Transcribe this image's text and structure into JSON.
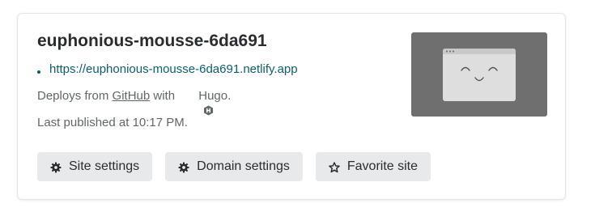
{
  "site": {
    "name": "euphonious-mousse-6da691",
    "url": "https://euphonious-mousse-6da691.netlify.app",
    "deploy_prefix": "Deploys from ",
    "deploy_provider": "GitHub",
    "deploy_with": " with ",
    "deploy_framework": "Hugo",
    "deploy_suffix": ".",
    "last_published": "Last published at 10:17 PM."
  },
  "buttons": {
    "site_settings": "Site settings",
    "domain_settings": "Domain settings",
    "favorite_site": "Favorite site"
  },
  "icons": {
    "status_dot": "status-dot",
    "framework": "hugo-icon",
    "site_settings": "gear-icon",
    "domain_settings": "gear-icon",
    "favorite": "star-outline-icon",
    "preview": "browser-smiley-placeholder"
  },
  "colors": {
    "link": "#0b5f6f",
    "muted_text": "#616668",
    "heading": "#2a2d30",
    "button_bg": "#e7e9eb",
    "thumbnail_bg": "#6f6f6f"
  }
}
